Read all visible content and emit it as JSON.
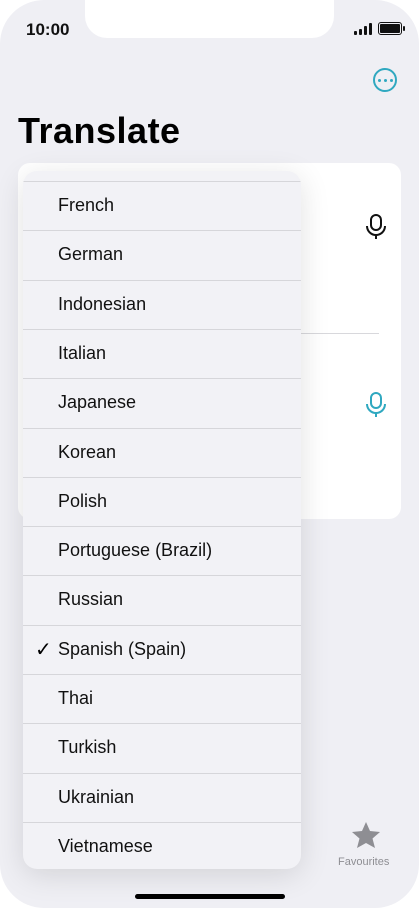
{
  "status_bar": {
    "time": "10:00"
  },
  "header": {
    "title": "Translate",
    "more_icon": "ellipsis-circle-icon"
  },
  "colors": {
    "accent": "#2fa8c0",
    "background": "#efeff4",
    "card": "#ffffff",
    "menu": "#f2f2f6"
  },
  "card": {
    "top_mic_icon": "microphone-icon",
    "bottom_mic_icon": "microphone-icon"
  },
  "language_menu": {
    "selected": "Spanish (Spain)",
    "items": [
      "French",
      "German",
      "Indonesian",
      "Italian",
      "Japanese",
      "Korean",
      "Polish",
      "Portuguese (Brazil)",
      "Russian",
      "Spanish (Spain)",
      "Thai",
      "Turkish",
      "Ukrainian",
      "Vietnamese"
    ],
    "check_glyph": "✓"
  },
  "tabbar": {
    "favourites_label": "Favourites",
    "favourites_icon": "star-icon"
  }
}
